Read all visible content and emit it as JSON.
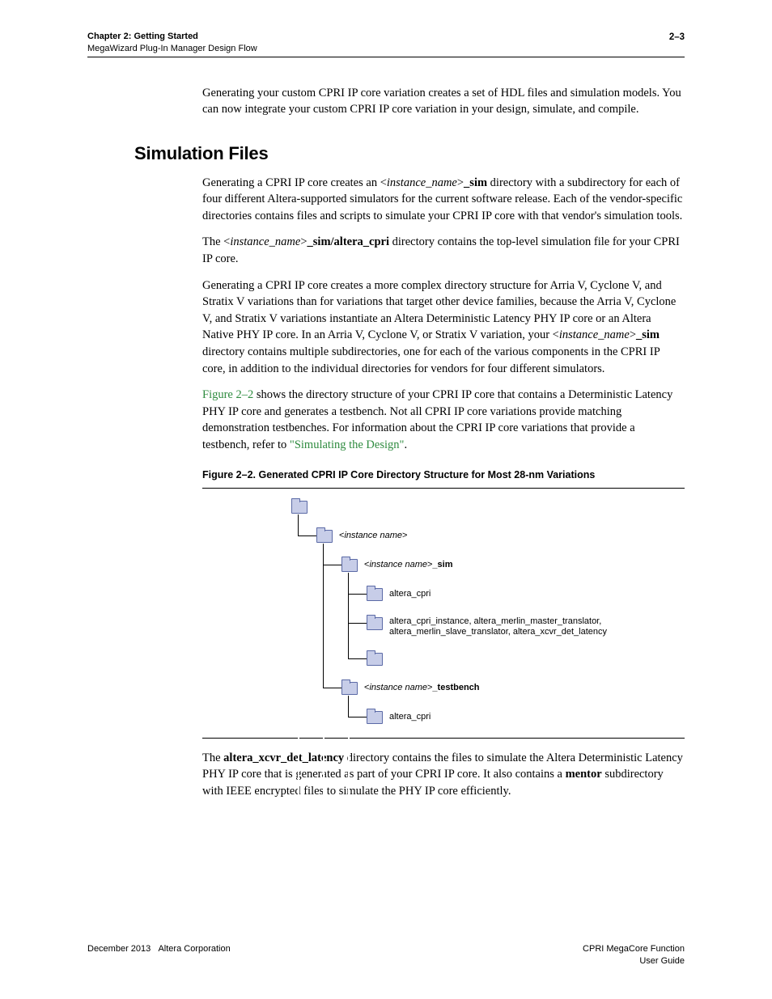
{
  "header": {
    "chapter": "Chapter 2: Getting Started",
    "sub": "MegaWizard Plug-In Manager Design Flow",
    "pagenum": "2–3"
  },
  "intro_para": "Generating your custom CPRI IP core variation creates a set of HDL files and simulation models. You can now integrate your custom CPRI IP core variation in your design, simulate, and compile.",
  "section_title": "Simulation Files",
  "p1_a": "Generating a CPRI IP core creates an <",
  "p1_b": "instance_name",
  "p1_c": ">",
  "p1_d": "_sim",
  "p1_e": " directory with a subdirectory for each of four different Altera-supported simulators for the current software release. Each of the vendor-specific directories contains files and scripts to simulate your CPRI IP core with that vendor's simulation tools.",
  "p2_a": "The <",
  "p2_b": "instance_name",
  "p2_c": ">",
  "p2_d": "_sim/altera_cpri",
  "p2_e": " directory contains the top-level simulation file for your CPRI IP core.",
  "p3_a": "Generating a CPRI IP core creates a more complex directory structure for Arria V, Cyclone V, and Stratix V variations than for variations that target other device families, because the Arria V, Cyclone V, and Stratix V variations instantiate an Altera Deterministic Latency PHY IP core or an Altera Native PHY IP core. In an Arria V, Cyclone V, or Stratix V variation, your <",
  "p3_b": "instance_name",
  "p3_c": ">",
  "p3_d": "_sim",
  "p3_e": " directory contains multiple subdirectories, one for each of the various components in the CPRI IP core, in addition to the individual directories for vendors for four different simulators.",
  "p4_ref": "Figure 2–2",
  "p4_a": " shows the directory structure of your CPRI IP core that contains a Deterministic Latency PHY IP core and generates a testbench. Not all CPRI IP core variations provide matching demonstration testbenches. For information about the CPRI IP core variations that provide a testbench, refer to ",
  "p4_link": "\"Simulating the Design\"",
  "p4_end": ".",
  "fig_caption": "Figure 2–2.  Generated CPRI IP Core Directory Structure for Most 28-nm Variations",
  "tree": {
    "n1_a": "<",
    "n1_b": "instance name",
    "n1_c": ">",
    "n2_a": "<",
    "n2_b": "instance name",
    "n2_c": ">",
    "n2_d": "_sim",
    "n3": "altera_cpri",
    "n4": "altera_cpri_instance, altera_merlin_master_translator, altera_merlin_slave_translator, altera_xcvr_det_latency",
    "n5_empty": "",
    "n6_a": "<",
    "n6_b": "instance name",
    "n6_c": ">",
    "n6_d": "_testbench",
    "n7": "altera_cpri"
  },
  "p5_a": "The ",
  "p5_b": "altera_xcvr_det_latency",
  "p5_c": " directory contains the files to simulate the Altera Deterministic Latency PHY IP core that is generated as part of your CPRI IP core. It also contains a ",
  "p5_d": "mentor",
  "p5_e": " subdirectory with IEEE encrypted files to simulate the PHY IP core efficiently.",
  "footer": {
    "left_date": "December 2013",
    "left_corp": "Altera Corporation",
    "right_l1": "CPRI MegaCore Function",
    "right_l2": "User Guide"
  }
}
